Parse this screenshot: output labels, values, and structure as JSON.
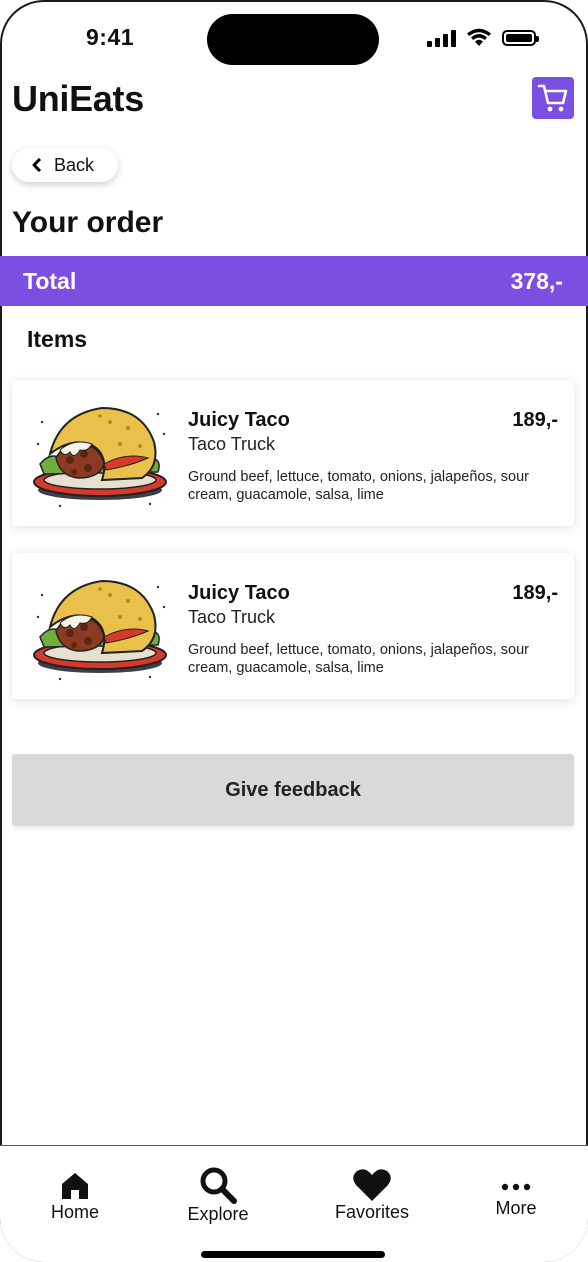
{
  "status_bar": {
    "time": "9:41"
  },
  "header": {
    "app_title": "UniEats"
  },
  "nav": {
    "back_label": "Back"
  },
  "order": {
    "title": "Your order",
    "total_label": "Total",
    "total_value": "378,-",
    "items_label": "Items",
    "items": [
      {
        "name": "Juicy Taco",
        "price": "189,-",
        "vendor": "Taco Truck",
        "description": "Ground beef, lettuce, tomato, onions, jalapeños, sour cream, guacamole, salsa, lime"
      },
      {
        "name": "Juicy Taco",
        "price": "189,-",
        "vendor": "Taco Truck",
        "description": "Ground beef, lettuce, tomato, onions, jalapeños, sour cream, guacamole, salsa, lime"
      }
    ]
  },
  "feedback_button": "Give feedback",
  "tabbar": {
    "home": "Home",
    "explore": "Explore",
    "favorites": "Favorites",
    "more": "More"
  },
  "colors": {
    "accent": "#7b4fe2",
    "button_gray": "#d9d9d9"
  },
  "icons": [
    "cart-icon",
    "chevron-left-icon",
    "home-icon",
    "search-icon",
    "heart-icon",
    "more-icon",
    "taco-image"
  ]
}
